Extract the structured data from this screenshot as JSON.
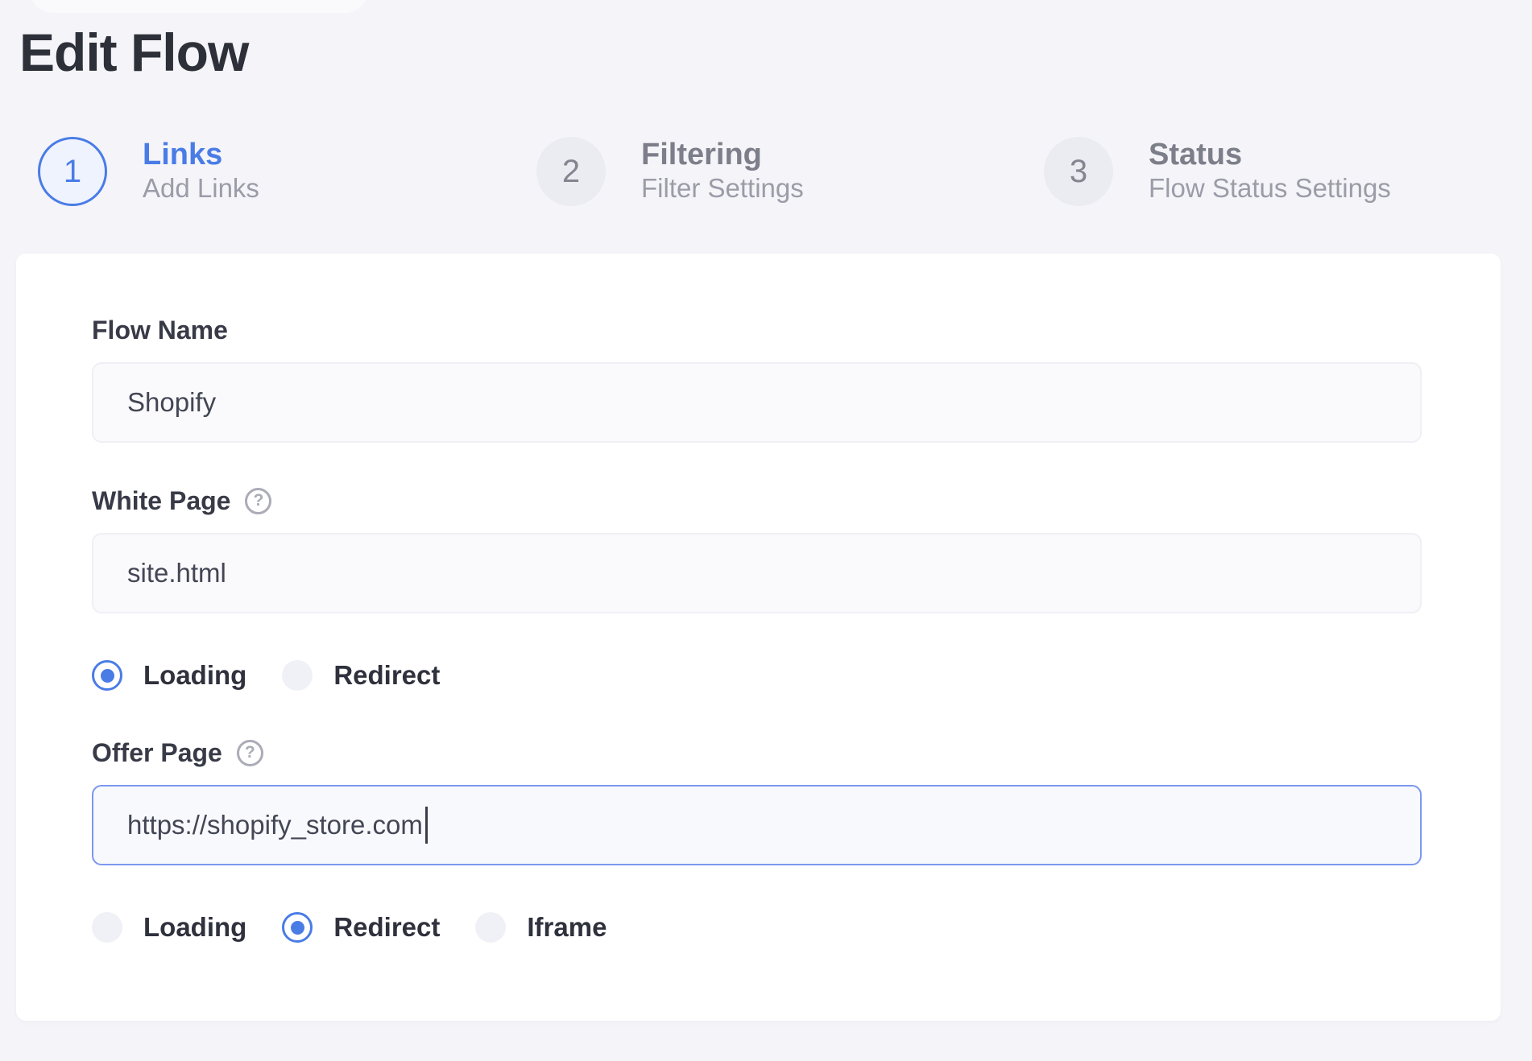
{
  "page": {
    "title": "Edit Flow"
  },
  "steps": [
    {
      "number": "1",
      "title": "Links",
      "subtitle": "Add Links",
      "state": "active"
    },
    {
      "number": "2",
      "title": "Filtering",
      "subtitle": "Filter Settings",
      "state": "inactive"
    },
    {
      "number": "3",
      "title": "Status",
      "subtitle": "Flow Status Settings",
      "state": "inactive"
    }
  ],
  "form": {
    "flow_name": {
      "label": "Flow Name",
      "value": "Shopify"
    },
    "white_page": {
      "label": "White Page",
      "help_icon": "question-mark-icon",
      "value": "site.html",
      "mode_options": [
        {
          "label": "Loading",
          "selected": true
        },
        {
          "label": "Redirect",
          "selected": false
        }
      ]
    },
    "offer_page": {
      "label": "Offer Page",
      "help_icon": "question-mark-icon",
      "value": "https://shopify_store.com",
      "focused": true,
      "mode_options": [
        {
          "label": "Loading",
          "selected": false
        },
        {
          "label": "Redirect",
          "selected": true
        },
        {
          "label": "Iframe",
          "selected": false
        }
      ]
    }
  },
  "colors": {
    "accent_blue": "#4a7ce6",
    "focus_border": "#7b97ef",
    "page_background": "#f4f4f9",
    "card_background": "#ffffff",
    "heading_text": "#2d3039",
    "muted_text": "#9b9ca7",
    "input_background": "#fafafc"
  }
}
